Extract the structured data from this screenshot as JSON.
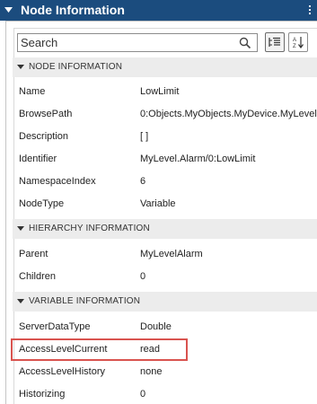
{
  "title": "Node Information",
  "search": {
    "placeholder": "Search"
  },
  "sections": {
    "node": {
      "label": "NODE INFORMATION",
      "rows": [
        {
          "k": "Name",
          "v": "LowLimit"
        },
        {
          "k": "BrowsePath",
          "v": "0:Objects.MyObjects.MyDevice.MyLevel"
        },
        {
          "k": "Description",
          "v": "[ ]"
        },
        {
          "k": "Identifier",
          "v": "MyLevel.Alarm/0:LowLimit"
        },
        {
          "k": "NamespaceIndex",
          "v": "6"
        },
        {
          "k": "NodeType",
          "v": "Variable"
        }
      ]
    },
    "hierarchy": {
      "label": "HIERARCHY INFORMATION",
      "rows": [
        {
          "k": "Parent",
          "v": "MyLevelAlarm"
        },
        {
          "k": "Children",
          "v": "0"
        }
      ]
    },
    "variable": {
      "label": "VARIABLE INFORMATION",
      "rows": [
        {
          "k": "ServerDataType",
          "v": "Double"
        },
        {
          "k": "AccessLevelCurrent",
          "v": "read"
        },
        {
          "k": "AccessLevelHistory",
          "v": "none"
        },
        {
          "k": "Historizing",
          "v": "0"
        }
      ]
    }
  },
  "colors": {
    "titlebar": "#1b4c7e",
    "highlight": "#d9534f",
    "section_bg": "#ececec"
  },
  "icons": [
    "collapse-triangle-icon",
    "more-options-icon",
    "search-icon",
    "categorize-icon",
    "sort-alphabetical-icon"
  ]
}
